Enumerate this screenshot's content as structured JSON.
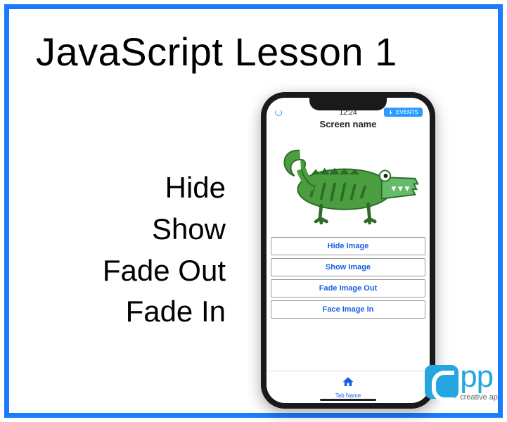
{
  "title": "JavaScript Lesson 1",
  "actions": {
    "hide": "Hide",
    "show": "Show",
    "fadeout": "Fade Out",
    "fadein": "Fade In"
  },
  "phone": {
    "time": "12:24",
    "events_label": "EVENTS",
    "screen_title": "Screen name",
    "image_name": "crocodile-image",
    "buttons": {
      "hide": "Hide Image",
      "show": "Show Image",
      "fadeout": "Fade Image Out",
      "fadein": "Face Image In"
    },
    "tab_label": "Tab Name"
  },
  "brand": {
    "letters": "pp",
    "tagline": "creative ap"
  },
  "colors": {
    "frame": "#1a7cfc",
    "accent": "#2b9cff",
    "link": "#1a5fe0",
    "brand": "#24a7e0",
    "croc_dark": "#2e7d32",
    "croc_light": "#66bb6a"
  }
}
